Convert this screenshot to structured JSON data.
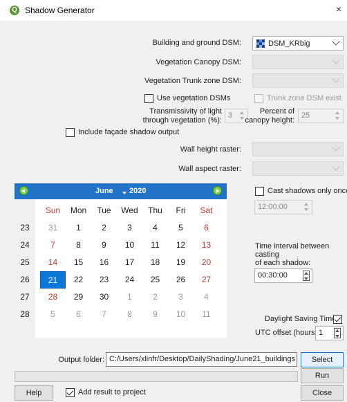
{
  "window": {
    "title": "Shadow Generator",
    "close_glyph": "×"
  },
  "inputs": {
    "building_dsm": {
      "label": "Building and ground DSM:",
      "value": "DSM_KRbig"
    },
    "canopy_dsm": {
      "label": "Vegetation Canopy DSM:"
    },
    "trunk_dsm": {
      "label": "Vegetation Trunk zone DSM:"
    },
    "use_veg": {
      "label": "Use vegetation DSMs",
      "checked": false
    },
    "trunk_exist": {
      "label": "Trunk zone DSM exist",
      "checked": false
    },
    "transmissivity": {
      "label_line1": "Transmissivity of light",
      "label_line2": "through vegetation (%):",
      "value": "3"
    },
    "percent_canopy": {
      "label_line1": "Percent of",
      "label_line2": "canopy height:",
      "value": "25"
    },
    "facade": {
      "label": "Include façade shadow output",
      "checked": false
    },
    "wall_height": {
      "label": "Wall height raster:"
    },
    "wall_aspect": {
      "label": "Wall aspect raster:"
    }
  },
  "calendar": {
    "month": "June",
    "year": "2020",
    "weekdays": [
      "Sun",
      "Mon",
      "Tue",
      "Wed",
      "Thu",
      "Fri",
      "Sat"
    ],
    "weeks": [
      {
        "num": "23",
        "days": [
          {
            "d": "31",
            "t": "gray"
          },
          {
            "d": "1"
          },
          {
            "d": "2"
          },
          {
            "d": "3"
          },
          {
            "d": "4"
          },
          {
            "d": "5"
          },
          {
            "d": "6",
            "t": "red"
          }
        ]
      },
      {
        "num": "24",
        "days": [
          {
            "d": "7",
            "t": "red"
          },
          {
            "d": "8"
          },
          {
            "d": "9"
          },
          {
            "d": "10"
          },
          {
            "d": "11"
          },
          {
            "d": "12"
          },
          {
            "d": "13",
            "t": "red"
          }
        ]
      },
      {
        "num": "25",
        "days": [
          {
            "d": "14",
            "t": "red"
          },
          {
            "d": "15"
          },
          {
            "d": "16"
          },
          {
            "d": "17"
          },
          {
            "d": "18"
          },
          {
            "d": "19"
          },
          {
            "d": "20",
            "t": "red"
          }
        ]
      },
      {
        "num": "26",
        "days": [
          {
            "d": "21",
            "t": "sel"
          },
          {
            "d": "22"
          },
          {
            "d": "23"
          },
          {
            "d": "24"
          },
          {
            "d": "25"
          },
          {
            "d": "26"
          },
          {
            "d": "27",
            "t": "red"
          }
        ]
      },
      {
        "num": "27",
        "days": [
          {
            "d": "28",
            "t": "red"
          },
          {
            "d": "29"
          },
          {
            "d": "30"
          },
          {
            "d": "1",
            "t": "gray"
          },
          {
            "d": "2",
            "t": "gray"
          },
          {
            "d": "3",
            "t": "gray"
          },
          {
            "d": "4",
            "t": "gray"
          }
        ]
      },
      {
        "num": "28",
        "days": [
          {
            "d": "5",
            "t": "gray"
          },
          {
            "d": "6",
            "t": "gray"
          },
          {
            "d": "7",
            "t": "gray"
          },
          {
            "d": "8",
            "t": "gray"
          },
          {
            "d": "9",
            "t": "gray"
          },
          {
            "d": "10",
            "t": "gray"
          },
          {
            "d": "11",
            "t": "gray"
          }
        ]
      }
    ]
  },
  "right_panel": {
    "cast_once": {
      "label": "Cast shadows only once",
      "checked": false
    },
    "time_once": "12:00:00",
    "interval_label_1": "Time interval between",
    "interval_label_2": "casting",
    "interval_label_3": "of each shadow:",
    "interval_value": "00:30:00",
    "dst": {
      "label": "Daylight Saving Time?",
      "checked": true
    },
    "utc": {
      "label": "UTC offset (hours):",
      "value": "1"
    }
  },
  "output": {
    "label": "Output folder:",
    "path": "C:/Users/xlinfr/Desktop/DailyShading/June21_buildings",
    "select_label": "Select"
  },
  "buttons": {
    "run": "Run",
    "help": "Help",
    "close": "Close"
  },
  "add_result": {
    "label": "Add result to project",
    "checked": true
  },
  "colors": {
    "accent": "#0b78d7",
    "header_blue": "#2173c8",
    "weekend_red": "#c0392b"
  }
}
